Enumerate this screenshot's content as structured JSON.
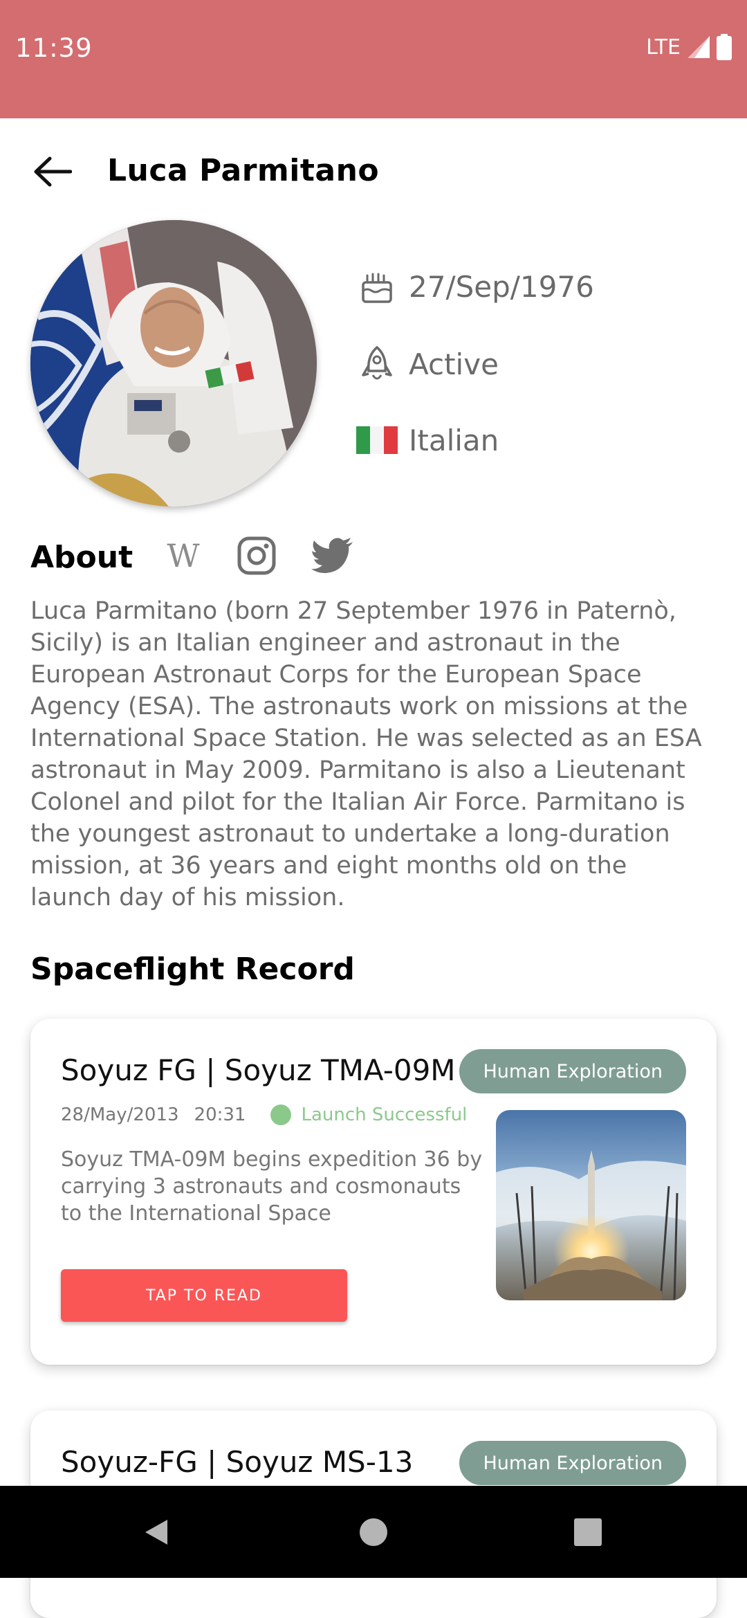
{
  "status_bar": {
    "time": "11:39",
    "network": "LTE",
    "icons": [
      "signal-icon",
      "battery-icon"
    ],
    "color": "#d36d6f"
  },
  "header": {
    "title": "Luca Parmitano",
    "back_icon": "arrow-left-icon"
  },
  "profile": {
    "birth_date": "27/Sep/1976",
    "status": "Active",
    "nationality": "Italian",
    "icons": {
      "birth": "cake-icon",
      "status": "rocket-icon",
      "nationality": "italy-flag-icon"
    }
  },
  "about": {
    "title": "About",
    "social": {
      "wiki_glyph": "W",
      "icons": [
        "wikipedia-icon",
        "instagram-icon",
        "twitter-icon"
      ]
    },
    "body": "Luca Parmitano (born 27 September 1976 in Paternò, Sicily) is an Italian engineer and astronaut in the European Astronaut Corps for the European Space Agency (ESA). The astronauts work on missions at the International Space Station. He was selected as an ESA astronaut in May 2009. Parmitano is also a Lieutenant Colonel and pilot for the Italian Air Force. Parmitano is the youngest astronaut to undertake a long-duration mission, at 36 years and eight months old on the launch day of his mission."
  },
  "spaceflight": {
    "title": "Spaceflight Record",
    "missions": [
      {
        "title": "Soyuz FG | Soyuz TMA-09M",
        "tag": "Human Exploration",
        "date": "28/May/2013",
        "time": "20:31",
        "status": "Launch Successful",
        "description": "Soyuz TMA-09M begins expedition 36 by carrying 3 astronauts and cosmonauts to the International Space",
        "button": "TAP TO READ"
      },
      {
        "title": "Soyuz-FG | Soyuz MS-13",
        "tag": "Human Exploration"
      }
    ]
  },
  "colors": {
    "accent": "#fb5656",
    "chip": "#7f9d93",
    "success": "#8bc98b",
    "status_bar": "#d36d6f"
  },
  "nav_bar": {
    "icons": [
      "back-triangle-icon",
      "home-circle-icon",
      "recents-square-icon"
    ]
  }
}
